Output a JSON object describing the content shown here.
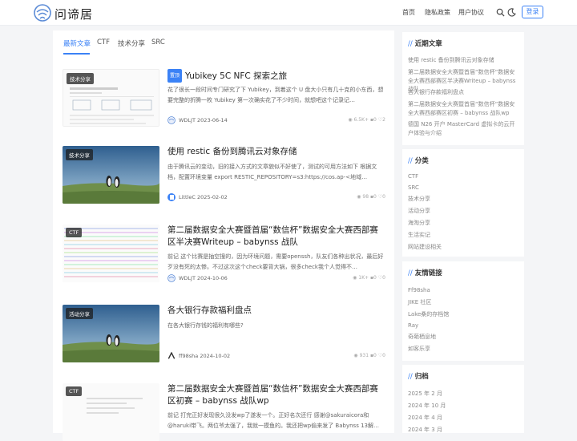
{
  "header": {
    "site_title": "问谛居",
    "nav": [
      "首页",
      "隐私政策",
      "用户协议"
    ],
    "login_label": "登录"
  },
  "main": {
    "tabs": [
      "最新文章",
      "CTF",
      "技术分享",
      "SRC"
    ],
    "posts": [
      {
        "category": "技术分享",
        "pinned_label": "置顶",
        "title": "Yubikey 5C NFC 探索之旅",
        "excerpt": "花了很长一段时间专门研究了下 Yubikey，到着这个 U 盘大小只有几十克的小东西，想要完整的折腾一枚 Yubikey 第一次确实花了不少时间，就想吧这个记录记…",
        "author": "WDLJT",
        "date": "2023-06-14",
        "views": "6.5K+",
        "comments": "0",
        "likes": "2"
      },
      {
        "category": "技术分享",
        "title": "使用 restic 备份到腾讯云对象存储",
        "excerpt": "由于腾讯云的变动，旧的接入方式的文章貌似不好使了，测试的可用方法如下 根据文档，配置环境变量 export RESTIC_REPOSITORY=s3:https://cos.ap-<地域…",
        "author": "LittleC",
        "date": "2025-02-02",
        "views": "98",
        "comments": "0",
        "likes": "0"
      },
      {
        "category": "CTF",
        "title": "第二届数据安全大赛暨首届“数信杯”数据安全大赛西部赛区半决赛Writeup – babynss 战队",
        "excerpt": "前记 这个比赛是抽空搜的，因为环境问题，需要openssh，队友们各种出状况，最后好歹没有死的太惨。不过这次这个check要背大锅，很多check我个人觉得不…",
        "author": "WDLJT",
        "date": "2024-10-06",
        "views": "1K+",
        "comments": "0",
        "likes": "0"
      },
      {
        "category": "活动分享",
        "title": "各大银行存款福利盘点",
        "excerpt": "在各大银行存钱的福利有哪些?",
        "author": "ff98sha",
        "date": "2024-10-02",
        "views": "931",
        "comments": "0",
        "likes": "0"
      },
      {
        "category": "CTF",
        "title": "第二届数据安全大赛暨首届“数信杯”数据安全大赛西部赛区初赛 – babynss 战队wp",
        "excerpt": "前记 打完正好发现很久没发wp了遂发一个。正好名次还行 感谢@sakuraicora和@haruki带飞。两位爷太强了，我就一摸鱼的。我还把wp偷来发了 Babynss 13解…"
      }
    ]
  },
  "sidebar": {
    "recent": {
      "title": "近期文章",
      "items": [
        "使用 restic 备份到腾讯云对象存储",
        "第二届数据安全大赛暨首届“数信杯”数据安全大赛西部赛区半决赛Writeup – babynss 战队",
        "各大银行存款福利盘点",
        "第二届数据安全大赛暨首届“数信杯”数据安全大赛西部赛区初赛 – babynss 战队wp",
        "德国 N26 开户 MasterCard 虚拟卡的云开户体验与介绍"
      ]
    },
    "categories": {
      "title": "分类",
      "items": [
        "CTF",
        "SRC",
        "技术分享",
        "活动分享",
        "海淘分享",
        "生活实记",
        "网站建设相关"
      ]
    },
    "links": {
      "title": "友情链接",
      "items": [
        "Ff98sha",
        "JIKE 社区",
        "Lake桑的存档馆",
        "Ray",
        "奇葩栖息地",
        "如客乐享"
      ]
    },
    "archives": {
      "title": "归档",
      "items": [
        "2025 年 2 月",
        "2024 年 10 月",
        "2024 年 4 月",
        "2024 年 3 月"
      ]
    }
  }
}
